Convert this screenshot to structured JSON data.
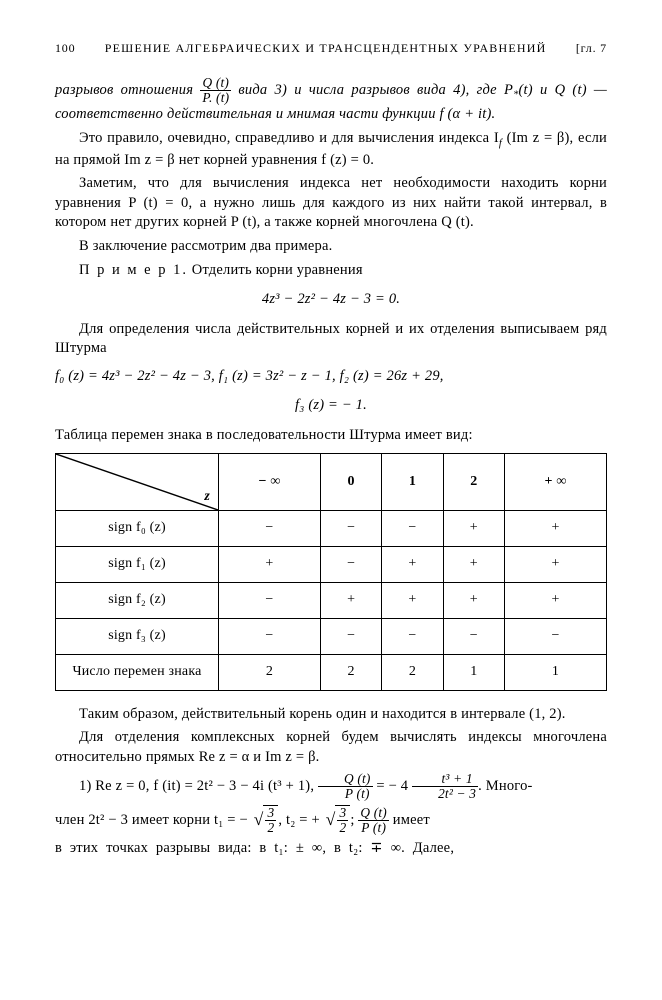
{
  "header": {
    "page_num": "100",
    "title": "РЕШЕНИЕ АЛГЕБРАИЧЕСКИХ И ТРАНСЦЕНДЕНТНЫХ УРАВНЕНИЙ",
    "chapter": "[гл. 7"
  },
  "p1a": "разрывов отношения ",
  "p1b": " вида 3) и числа разрывов вида 4), где P",
  "p1c": "(t) и Q (t) — соответственно действительная и мнимая части функции f (α + it).",
  "frac1_num": "Q (t)",
  "frac1_den": "P. (t)",
  "p2": "Это правило, очевидно, справедливо и для вычисления индекса I",
  "p2b": " (Im z = β), если на прямой Im z = β нет корней уравнения f (z) = 0.",
  "p3": "Заметим, что для вычисления индекса нет необходимости находить корни уравнения P (t) = 0, а нужно лишь для каждого из них найти такой интервал, в котором нет других корней P (t), а также корней многочлена Q (t).",
  "p4": "В заключение рассмотрим два примера.",
  "p5a": "П р и м е р  1.",
  "p5b": " Отделить корни уравнения",
  "eq1": "4z³ − 2z² − 4z − 3 = 0.",
  "p6": "Для определения числа действительных корней и их отделения выписываем ряд Штурма",
  "eq2a": "f₀ (z) = 4z³ − 2z² − 4z − 3,   f₁ (z) = 3z² − z − 1,   f₂ (z) = 26z + 29,",
  "eq2b": "f₃ (z) = − 1.",
  "p7": "Таблица перемен знака в последовательности Штурма имеет вид:",
  "table": {
    "header_z": "z",
    "cols": [
      "− ∞",
      "0",
      "1",
      "2",
      "+ ∞"
    ],
    "rows": [
      {
        "label": "sign f₀ (z)",
        "vals": [
          "−",
          "−",
          "−",
          "+",
          "+"
        ]
      },
      {
        "label": "sign f₁ (z)",
        "vals": [
          "+",
          "−",
          "+",
          "+",
          "+"
        ]
      },
      {
        "label": "sign f₂ (z)",
        "vals": [
          "−",
          "+",
          "+",
          "+",
          "+"
        ]
      },
      {
        "label": "sign f₃ (z)",
        "vals": [
          "−",
          "−",
          "−",
          "−",
          "−"
        ]
      }
    ],
    "footer_label": "Число перемен знака",
    "footer_vals": [
      "2",
      "2",
      "2",
      "1",
      "1"
    ]
  },
  "p8": "Таким образом, действительный корень один и находится в интервале (1, 2).",
  "p9": "Для отделения комплексных корней будем вычислять индексы многочлена относительно прямых Re z = α и Im z = β.",
  "p10a": "1) Re z = 0, f (it) = 2t² − 3 − 4i (t³ + 1), ",
  "p10_fracQP_num": "Q (t)",
  "p10_fracQP_den": "P (t)",
  "p10_eq_mid": " = − 4 ",
  "p10_frac2_num": "t³ + 1",
  "p10_frac2_den": "2t² − 3",
  "p10b": ". Много-",
  "p11a": "член 2t² − 3 имеет корни t₁ = − ",
  "p11_root_num": "3",
  "p11_root_den": "2",
  "p11b": ", t₂ = + ",
  "p11c": "; ",
  "p11_fracQP2_num": "Q (t)",
  "p11_fracQP2_den": "P (t)",
  "p11d": " имеет",
  "p12": "в этих точках разрывы вида: в t₁: ± ∞, в t₂: ∓ ∞. Далее,"
}
